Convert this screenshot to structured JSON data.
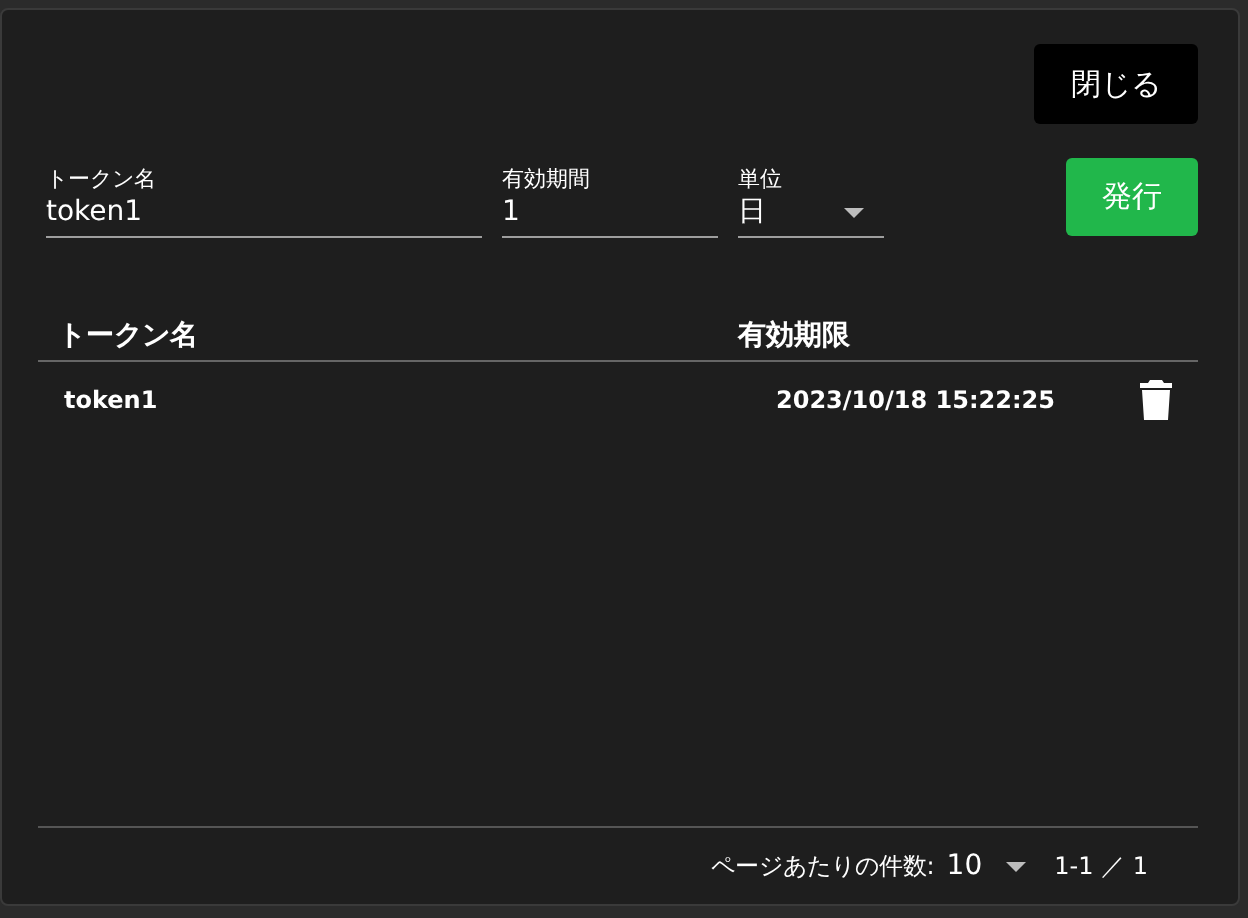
{
  "close_button": "閉じる",
  "form": {
    "fields": [
      {
        "kind": "text",
        "label": "トークン名",
        "value": "token1"
      },
      {
        "kind": "text",
        "label": "有効期間",
        "value": "1"
      },
      {
        "kind": "select",
        "label": "単位",
        "value": "日"
      }
    ],
    "issue_button": "発行"
  },
  "table": {
    "columns": [
      "トークン名",
      "有効期限"
    ],
    "rows": [
      {
        "name": "token1",
        "expires": "2023/10/18 15:22:25"
      }
    ]
  },
  "pagination": {
    "per_page_label": "ページあたりの件数:",
    "per_page": "10",
    "range": "1-1 ／ 1"
  }
}
